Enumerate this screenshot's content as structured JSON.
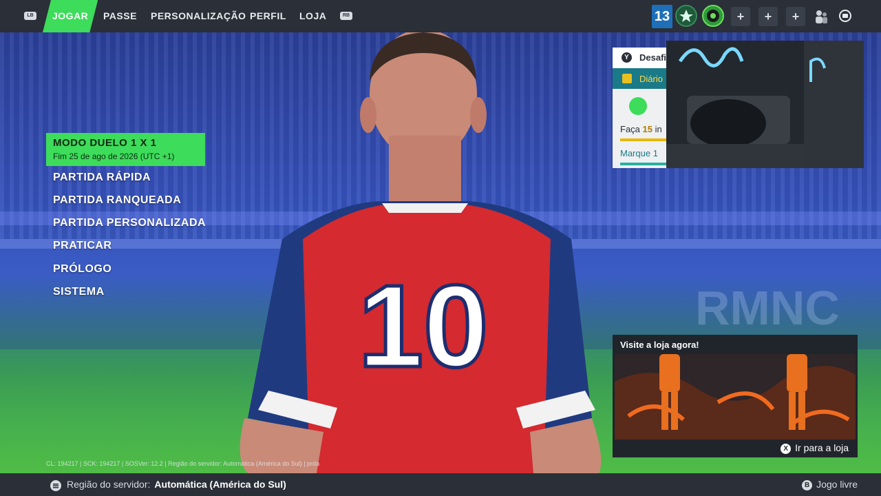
{
  "topbar": {
    "lb_label": "LB",
    "rb_label": "RB",
    "tabs": [
      {
        "label": "JOGAR",
        "active": true
      },
      {
        "label": "PASSE"
      },
      {
        "label": "PERSONALIZAÇÃO"
      },
      {
        "label": "PERFIL"
      },
      {
        "label": "LOJA"
      }
    ],
    "level": "13",
    "plus_label": "+",
    "icons": [
      "rank-badge-icon",
      "ball-badge-icon",
      "friends-icon",
      "chat-icon"
    ]
  },
  "menu": {
    "selected": {
      "title": "MODO DUELO 1 X 1",
      "subtitle": "Fim 25 de ago de 2026 (UTC +1)"
    },
    "items": [
      "PARTIDA RÁPIDA",
      "PARTIDA RANQUEADA",
      "PARTIDA PERSONALIZADA",
      "PRATICAR",
      "PRÓLOGO",
      "SISTEMA"
    ]
  },
  "challenge": {
    "button": "Y",
    "title": "Desafi",
    "tab": "Diário",
    "task1_prefix": "Faça ",
    "task1_count": "15",
    "task1_suffix": " in",
    "task2": "Marque 1"
  },
  "shop": {
    "header": "Visite a loja agora!",
    "button": "X",
    "link": "Ir para a loja"
  },
  "debug": "CL: 194217 | SCK: 194217 | SOSVer: 12.2 | Região do servidor: Automática (América do Sul) | prdа",
  "footer": {
    "region_label": "Região do servidor:",
    "region_value": "Automática (América do Sul)",
    "free_button": "B",
    "free_label": "Jogo livre"
  },
  "player": {
    "number": "10"
  },
  "colors": {
    "accent": "#3ddc5a",
    "bar": "#2a2f38",
    "level": "#1f6fb8"
  }
}
